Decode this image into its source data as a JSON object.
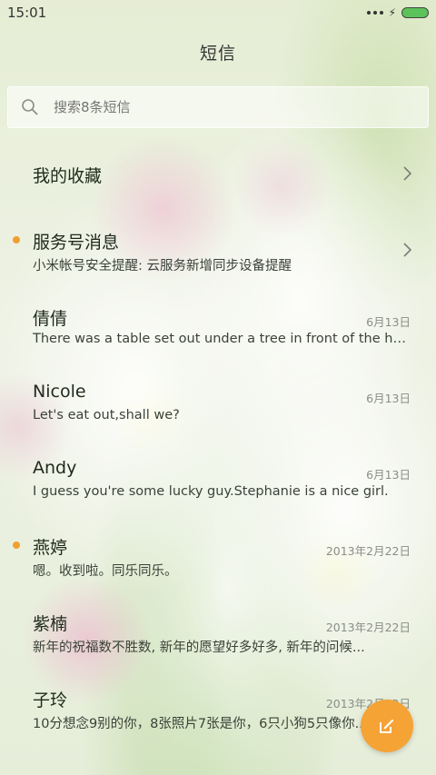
{
  "status_bar": {
    "time": "15:01"
  },
  "header": {
    "title": "短信"
  },
  "search": {
    "placeholder": "搜索8条短信"
  },
  "threads": [
    {
      "title": "我的收藏",
      "preview": "",
      "date": "",
      "unread": false,
      "chevron": true
    },
    {
      "title": "服务号消息",
      "preview": "小米帐号安全提醒: 云服务新增同步设备提醒",
      "date": "",
      "unread": true,
      "chevron": true
    },
    {
      "title": "倩倩",
      "preview": "There was a table set out under a tree in front of the ho...",
      "date": "6月13日",
      "unread": false,
      "chevron": false
    },
    {
      "title": "Nicole",
      "preview": "Let's eat out,shall we?",
      "date": "6月13日",
      "unread": false,
      "chevron": false
    },
    {
      "title": "Andy",
      "preview": "I guess you're some lucky guy.Stephanie is a nice girl.",
      "date": "6月13日",
      "unread": false,
      "chevron": false
    },
    {
      "title": "燕婷",
      "preview": "嗯。收到啦。同乐同乐。",
      "date": "2013年2月22日",
      "unread": true,
      "chevron": false
    },
    {
      "title": "紫楠",
      "preview": "新年的祝福数不胜数, 新年的愿望好多好多, 新年的问候...",
      "date": "2013年2月22日",
      "unread": false,
      "chevron": false
    },
    {
      "title": "子玲",
      "preview": "10分想念9别的你，8张照片7张是你，6只小狗5只像你...",
      "date": "2013年2月22日",
      "unread": false,
      "chevron": false
    }
  ],
  "colors": {
    "accent": "#f5a335",
    "unread_dot": "#f0a030",
    "battery": "#5cc35a"
  },
  "icons": {
    "search": "search-icon",
    "compose": "compose-icon",
    "chevron": "chevron-right-icon"
  }
}
